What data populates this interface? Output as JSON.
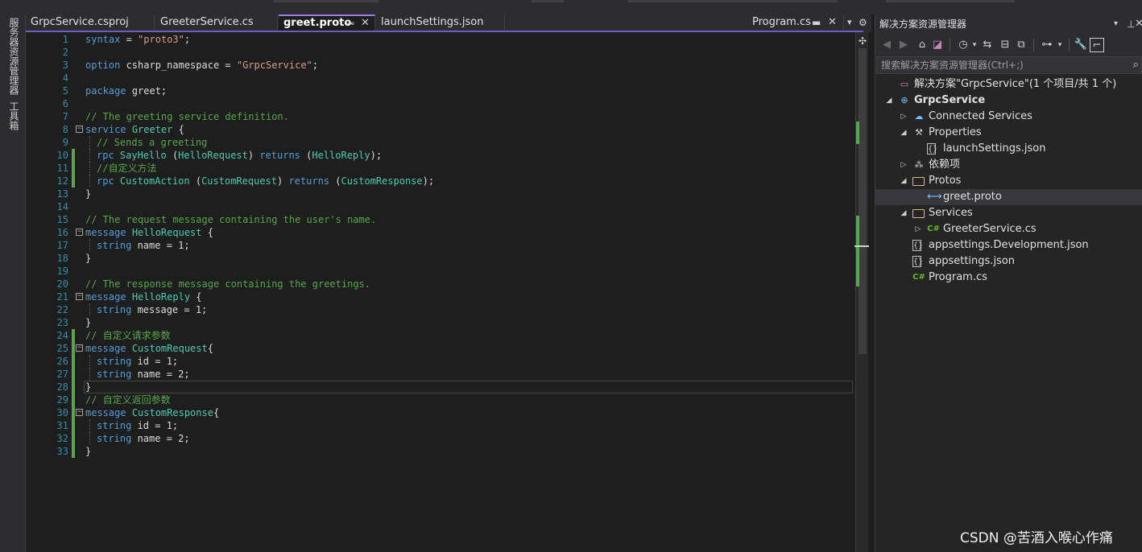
{
  "left_strip": {
    "tabs": [
      "服务器资源管理器",
      "工具箱"
    ]
  },
  "tabs": [
    {
      "label": "GrpcService.csproj",
      "active": false
    },
    {
      "label": "GreeterService.cs",
      "active": false
    },
    {
      "label": "greet.proto",
      "active": true
    },
    {
      "label": "launchSettings.json",
      "active": false
    },
    {
      "label": "Program.cs",
      "active": false
    }
  ],
  "editor": {
    "language": "proto",
    "lines": [
      {
        "n": "1",
        "segs": [
          [
            "kw",
            "syntax"
          ],
          [
            "pl",
            " = "
          ],
          [
            "str",
            "\"proto3\""
          ],
          [
            "pl",
            ";"
          ]
        ]
      },
      {
        "n": "2",
        "segs": []
      },
      {
        "n": "3",
        "segs": [
          [
            "kw",
            "option"
          ],
          [
            "pl",
            " csharp_namespace = "
          ],
          [
            "str",
            "\"GrpcService\""
          ],
          [
            "pl",
            ";"
          ]
        ]
      },
      {
        "n": "4",
        "segs": []
      },
      {
        "n": "5",
        "segs": [
          [
            "kw",
            "package"
          ],
          [
            "pl",
            " greet;"
          ]
        ]
      },
      {
        "n": "6",
        "segs": []
      },
      {
        "n": "7",
        "segs": [
          [
            "cm",
            "// The greeting service definition."
          ]
        ]
      },
      {
        "n": "8",
        "fold": true,
        "segs": [
          [
            "kw",
            "service"
          ],
          [
            "pl",
            " "
          ],
          [
            "ty",
            "Greeter"
          ],
          [
            "pl",
            " {"
          ]
        ]
      },
      {
        "n": "9",
        "indent": true,
        "segs": [
          [
            "cm",
            "// Sends a greeting"
          ]
        ]
      },
      {
        "n": "10",
        "indent": true,
        "changed": true,
        "segs": [
          [
            "kw",
            "rpc"
          ],
          [
            "pl",
            " "
          ],
          [
            "ty",
            "SayHello"
          ],
          [
            "pl",
            " ("
          ],
          [
            "ty",
            "HelloRequest"
          ],
          [
            "pl",
            ") "
          ],
          [
            "kw",
            "returns"
          ],
          [
            "pl",
            " ("
          ],
          [
            "ty",
            "HelloReply"
          ],
          [
            "pl",
            ");"
          ]
        ]
      },
      {
        "n": "11",
        "indent": true,
        "changed": true,
        "segs": [
          [
            "cm",
            "//自定义方法"
          ]
        ]
      },
      {
        "n": "12",
        "indent": true,
        "changed": true,
        "segs": [
          [
            "kw",
            "rpc"
          ],
          [
            "pl",
            " "
          ],
          [
            "ty",
            "CustomAction"
          ],
          [
            "pl",
            " ("
          ],
          [
            "ty",
            "CustomRequest"
          ],
          [
            "pl",
            ") "
          ],
          [
            "kw",
            "returns"
          ],
          [
            "pl",
            " ("
          ],
          [
            "ty",
            "CustomResponse"
          ],
          [
            "pl",
            ");"
          ]
        ]
      },
      {
        "n": "13",
        "segs": [
          [
            "pl",
            "}"
          ]
        ]
      },
      {
        "n": "14",
        "segs": []
      },
      {
        "n": "15",
        "segs": [
          [
            "cm",
            "// The request message containing the user's name."
          ]
        ]
      },
      {
        "n": "16",
        "fold": true,
        "segs": [
          [
            "kw",
            "message"
          ],
          [
            "pl",
            " "
          ],
          [
            "ty",
            "HelloRequest"
          ],
          [
            "pl",
            " {"
          ]
        ]
      },
      {
        "n": "17",
        "indent": true,
        "segs": [
          [
            "kw",
            "string"
          ],
          [
            "pl",
            " name = 1;"
          ]
        ]
      },
      {
        "n": "18",
        "segs": [
          [
            "pl",
            "}"
          ]
        ]
      },
      {
        "n": "19",
        "segs": []
      },
      {
        "n": "20",
        "segs": [
          [
            "cm",
            "// The response message containing the greetings."
          ]
        ]
      },
      {
        "n": "21",
        "fold": true,
        "segs": [
          [
            "kw",
            "message"
          ],
          [
            "pl",
            " "
          ],
          [
            "ty",
            "HelloReply"
          ],
          [
            "pl",
            " {"
          ]
        ]
      },
      {
        "n": "22",
        "indent": true,
        "segs": [
          [
            "kw",
            "string"
          ],
          [
            "pl",
            " message = 1;"
          ]
        ]
      },
      {
        "n": "23",
        "segs": [
          [
            "pl",
            "}"
          ]
        ]
      },
      {
        "n": "24",
        "changed": true,
        "segs": [
          [
            "cm",
            "// 自定义请求参数"
          ]
        ]
      },
      {
        "n": "25",
        "fold": true,
        "changed": true,
        "segs": [
          [
            "kw",
            "message"
          ],
          [
            "pl",
            " "
          ],
          [
            "ty",
            "CustomRequest"
          ],
          [
            "pl",
            "{"
          ]
        ]
      },
      {
        "n": "26",
        "indent": true,
        "changed": true,
        "segs": [
          [
            "kw",
            "string"
          ],
          [
            "pl",
            " id = 1;"
          ]
        ]
      },
      {
        "n": "27",
        "indent": true,
        "changed": true,
        "segs": [
          [
            "kw",
            "string"
          ],
          [
            "pl",
            " name = 2;"
          ]
        ]
      },
      {
        "n": "28",
        "changed": true,
        "current": true,
        "segs": [
          [
            "pl",
            "}"
          ]
        ]
      },
      {
        "n": "29",
        "changed": true,
        "segs": [
          [
            "cm",
            "// 自定义返回参数"
          ]
        ]
      },
      {
        "n": "30",
        "fold": true,
        "changed": true,
        "segs": [
          [
            "kw",
            "message"
          ],
          [
            "pl",
            " "
          ],
          [
            "ty",
            "CustomResponse"
          ],
          [
            "pl",
            "{"
          ]
        ]
      },
      {
        "n": "31",
        "indent": true,
        "changed": true,
        "segs": [
          [
            "kw",
            "string"
          ],
          [
            "pl",
            " id = 1;"
          ]
        ]
      },
      {
        "n": "32",
        "indent": true,
        "changed": true,
        "segs": [
          [
            "kw",
            "string"
          ],
          [
            "pl",
            " name = 2;"
          ]
        ]
      },
      {
        "n": "33",
        "changed": true,
        "segs": [
          [
            "pl",
            "}"
          ]
        ]
      }
    ]
  },
  "solution_explorer": {
    "title": "解决方案资源管理器",
    "search_placeholder": "搜索解决方案资源管理器(Ctrl+;)",
    "tree": [
      {
        "label": "解决方案\"GrpcService\"(1 个项目/共 1 个)",
        "icon": "solution-icon",
        "depth": 0,
        "arrow": ""
      },
      {
        "label": "GrpcService",
        "icon": "globe-project-icon",
        "depth": 0,
        "arrow": "down",
        "bold": true
      },
      {
        "label": "Connected Services",
        "icon": "connected-services-icon",
        "depth": 1,
        "arrow": "right"
      },
      {
        "label": "Properties",
        "icon": "wrench-icon",
        "depth": 1,
        "arrow": "down"
      },
      {
        "label": "launchSettings.json",
        "icon": "json-file-icon",
        "depth": 2,
        "arrow": ""
      },
      {
        "label": "依赖项",
        "icon": "dependencies-icon",
        "depth": 1,
        "arrow": "right"
      },
      {
        "label": "Protos",
        "icon": "folder-icon",
        "depth": 1,
        "arrow": "down"
      },
      {
        "label": "greet.proto",
        "icon": "proto-file-icon",
        "depth": 2,
        "arrow": "",
        "selected": true
      },
      {
        "label": "Services",
        "icon": "folder-icon",
        "depth": 1,
        "arrow": "down"
      },
      {
        "label": "GreeterService.cs",
        "icon": "csharp-file-icon",
        "depth": 2,
        "arrow": "right"
      },
      {
        "label": "appsettings.Development.json",
        "icon": "json-file-icon",
        "depth": 1,
        "arrow": ""
      },
      {
        "label": "appsettings.json",
        "icon": "json-file-icon",
        "depth": 1,
        "arrow": ""
      },
      {
        "label": "Program.cs",
        "icon": "csharp-file-icon",
        "depth": 1,
        "arrow": ""
      }
    ]
  },
  "watermark": "CSDN @苦酒入喉心作痛",
  "colors": {
    "keyword": "#569cd6",
    "type": "#4ec9b0",
    "string": "#d69d85",
    "comment": "#57a64a",
    "line_number": "#2b91af",
    "tab_accent": "#6e5ebf",
    "change_bar": "#57a64a"
  }
}
